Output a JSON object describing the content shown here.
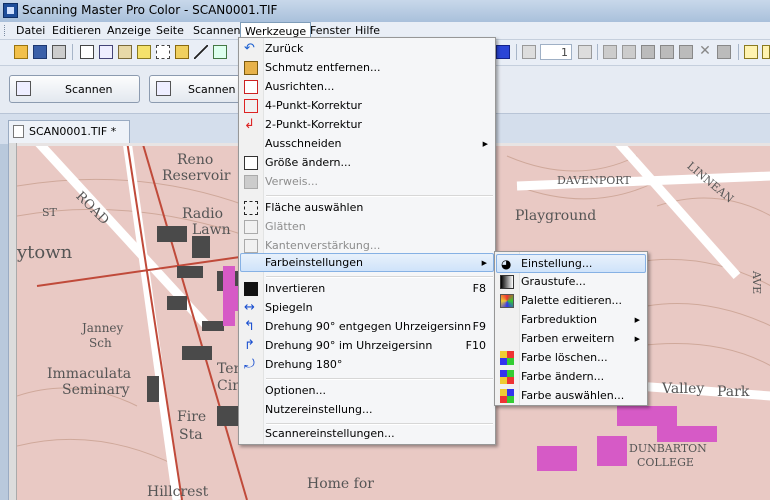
{
  "window": {
    "title": "Scanning Master Pro Color - SCAN0001.TIF"
  },
  "menubar": [
    "Datei",
    "Editieren",
    "Anzeige",
    "Seite",
    "Scannen",
    "Werkzeuge",
    "Fenster",
    "Hilfe"
  ],
  "toolbar": {
    "page_number": "1"
  },
  "scanbar": {
    "scan_label": "Scannen",
    "scan_and_label": "Scannen un"
  },
  "document": {
    "tab_title": "SCAN0001.TIF *"
  },
  "map_labels": [
    "Reno",
    "Reservoir",
    "ROAD",
    "Radio",
    "Lawn",
    "ytown",
    "Janney",
    "Sch",
    "Immaculata",
    "Seminary",
    "Ten",
    "Circ",
    "Fire",
    "Sta",
    "Home for",
    "Hillcrest",
    "ST",
    "DAVENPORT",
    "Playground",
    "LINNEAN",
    "AVE",
    "Valley",
    "Park",
    "DUNBARTON",
    "COLLEGE"
  ],
  "werkzeuge_menu": [
    {
      "label": "Zurück",
      "shortcut": "",
      "disabled": false,
      "submenu": false
    },
    {
      "label": "Schmutz entfernen...",
      "shortcut": "",
      "disabled": false,
      "submenu": false
    },
    {
      "label": "Ausrichten...",
      "shortcut": "",
      "disabled": false,
      "submenu": false
    },
    {
      "label": "4-Punkt-Korrektur",
      "shortcut": "",
      "disabled": false,
      "submenu": false
    },
    {
      "label": "2-Punkt-Korrektur",
      "shortcut": "",
      "disabled": false,
      "submenu": false
    },
    {
      "label": "Ausschneiden",
      "shortcut": "",
      "disabled": false,
      "submenu": true
    },
    {
      "label": "Größe ändern...",
      "shortcut": "",
      "disabled": false,
      "submenu": false
    },
    {
      "label": "Verweis...",
      "shortcut": "",
      "disabled": true,
      "submenu": false
    },
    {
      "label": "Fläche auswählen",
      "shortcut": "",
      "disabled": false,
      "submenu": false
    },
    {
      "label": "Glätten",
      "shortcut": "",
      "disabled": true,
      "submenu": false
    },
    {
      "label": "Kantenverstärkung...",
      "shortcut": "",
      "disabled": true,
      "submenu": false
    },
    {
      "label": "Farbeinstellungen",
      "shortcut": "",
      "disabled": false,
      "submenu": true
    },
    {
      "label": "Invertieren",
      "shortcut": "F8",
      "disabled": false,
      "submenu": false
    },
    {
      "label": "Spiegeln",
      "shortcut": "",
      "disabled": false,
      "submenu": false
    },
    {
      "label": "Drehung 90° entgegen Uhrzeigersinn",
      "shortcut": "F9",
      "disabled": false,
      "submenu": false
    },
    {
      "label": "Drehung 90° im Uhrzeigersinn",
      "shortcut": "F10",
      "disabled": false,
      "submenu": false
    },
    {
      "label": "Drehung 180°",
      "shortcut": "",
      "disabled": false,
      "submenu": false
    },
    {
      "label": "Optionen...",
      "shortcut": "",
      "disabled": false,
      "submenu": false
    },
    {
      "label": "Nutzereinstellung...",
      "shortcut": "",
      "disabled": false,
      "submenu": false
    },
    {
      "label": "Scannereinstellungen...",
      "shortcut": "",
      "disabled": false,
      "submenu": false
    }
  ],
  "farb_submenu": [
    {
      "label": "Einstellung...",
      "submenu": false
    },
    {
      "label": "Graustufe...",
      "submenu": false
    },
    {
      "label": "Palette editieren...",
      "submenu": false
    },
    {
      "label": "Farbreduktion",
      "submenu": true
    },
    {
      "label": "Farben erweitern",
      "submenu": true
    },
    {
      "label": "Farbe löschen...",
      "submenu": false
    },
    {
      "label": "Farbe ändern...",
      "submenu": false
    },
    {
      "label": "Farbe auswählen...",
      "submenu": false
    }
  ],
  "colors": {
    "menu_highlight": "#cfe3fa",
    "map_background": "#e9c9c4",
    "map_pink": "#d65ac6"
  }
}
